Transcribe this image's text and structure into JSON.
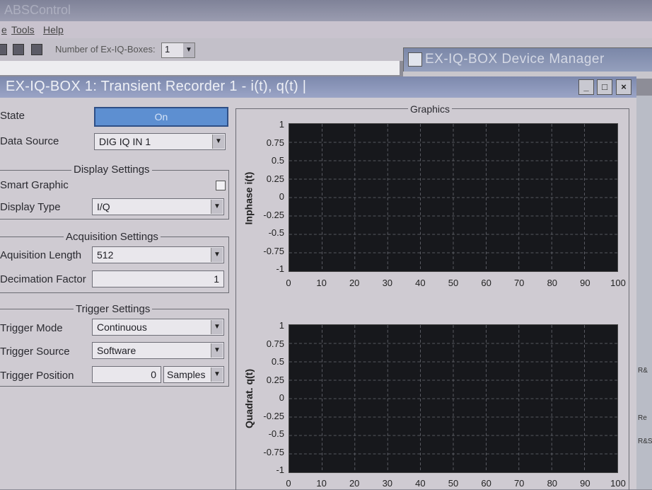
{
  "app": {
    "title": "ABSControl",
    "menu": [
      "e",
      "Tools",
      "Help"
    ],
    "toolbar": {
      "boxes_label": "Number of Ex-IQ-Boxes:",
      "boxes_value": "1"
    },
    "device_manager_title": "EX-IQ-BOX Device Manager"
  },
  "window": {
    "title": "EX-IQ-BOX 1: Transient Recorder 1 - i(t), q(t) |",
    "buttons": [
      "_",
      "□",
      "×"
    ]
  },
  "settings": {
    "state_label": "State",
    "state_value": "On",
    "data_source_label": "Data Source",
    "data_source_value": "DIG IQ IN 1",
    "display": {
      "title": "Display Settings",
      "smart_graphic_label": "Smart Graphic",
      "display_type_label": "Display Type",
      "display_type_value": "I/Q"
    },
    "acquisition": {
      "title": "Acquisition Settings",
      "length_label": "Aquisition Length",
      "length_value": "512",
      "decimation_label": "Decimation Factor",
      "decimation_value": "1"
    },
    "trigger": {
      "title": "Trigger Settings",
      "mode_label": "Trigger Mode",
      "mode_value": "Continuous",
      "source_label": "Trigger Source",
      "source_value": "Software",
      "position_label": "Trigger Position",
      "position_value": "0",
      "position_unit": "Samples"
    }
  },
  "graphics": {
    "title": "Graphics",
    "plots": [
      {
        "ylabel": "Inphase i(t)",
        "yticks": [
          "1",
          "0.75",
          "0.5",
          "0.25",
          "0",
          "-0.25",
          "-0.5",
          "-0.75",
          "-1"
        ],
        "xticks": [
          "0",
          "10",
          "20",
          "30",
          "40",
          "50",
          "60",
          "70",
          "80",
          "90",
          "100"
        ]
      },
      {
        "ylabel": "Quadrat. q(t)",
        "yticks": [
          "1",
          "0.75",
          "0.5",
          "0.25",
          "0",
          "-0.25",
          "-0.5",
          "-0.75",
          "-1"
        ],
        "xticks": [
          "0",
          "10",
          "20",
          "30",
          "40",
          "50",
          "60",
          "70",
          "80",
          "90",
          "100"
        ]
      }
    ]
  },
  "side_labels": [
    "R&",
    "Re",
    "R&S"
  ],
  "colors": {
    "state_on": "#5d8fd1",
    "plot_bg": "#17181c",
    "titlebar": "#8a95b8"
  }
}
